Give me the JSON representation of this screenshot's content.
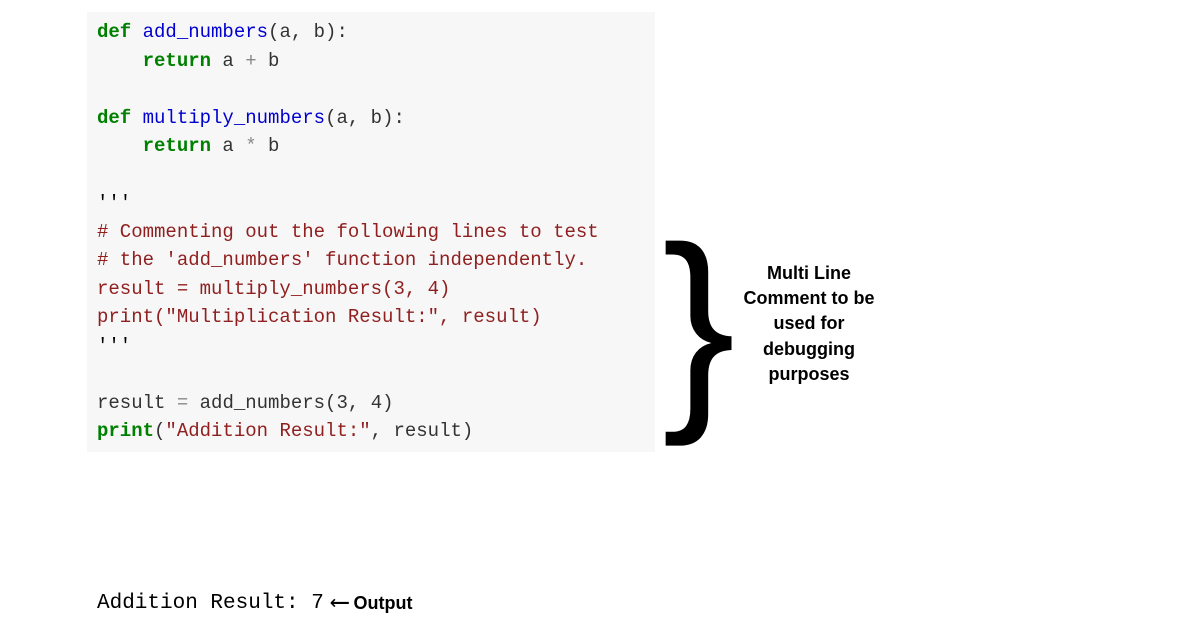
{
  "code": {
    "l1_def": "def",
    "l1_fn": " add_numbers",
    "l1_params": "(a, b):",
    "l2_indent": "    ",
    "l2_return": "return",
    "l2_expr": " a ",
    "l2_op": "+",
    "l2_b": " b",
    "l4_def": "def",
    "l4_fn": " multiply_numbers",
    "l4_params": "(a, b):",
    "l5_indent": "    ",
    "l5_return": "return",
    "l5_expr": " a ",
    "l5_op": "*",
    "l5_b": " b",
    "l7_quotes": "'''",
    "l8_comment": "# Commenting out the following lines to test",
    "l9_comment": "# the 'add_numbers' function independently.",
    "l10_code": "result = multiply_numbers(3, 4)",
    "l11_code": "print(\"Multiplication Result:\", result)",
    "l12_quotes": "'''",
    "l14_result": "result ",
    "l14_eq": "=",
    "l14_call": " add_numbers(",
    "l14_args": "3",
    "l14_comma": ", ",
    "l14_arg2": "4",
    "l14_close": ")",
    "l15_print": "print",
    "l15_open": "(",
    "l15_str": "\"Addition Result:\"",
    "l15_rest": ", result)"
  },
  "output": {
    "text": "Addition Result: 7",
    "label": "Output"
  },
  "annotation": {
    "text": "Multi Line\nComment to be\nused for\ndebugging\npurposes"
  }
}
